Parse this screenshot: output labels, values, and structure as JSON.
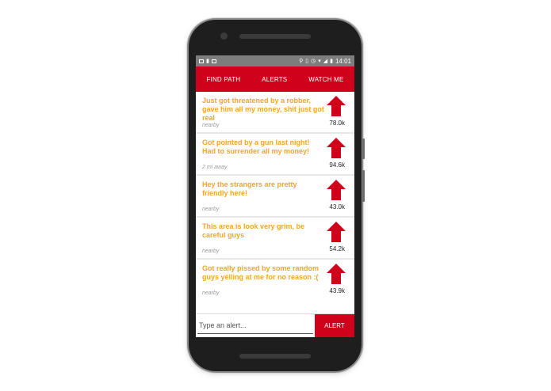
{
  "status_bar": {
    "time": "14:01"
  },
  "tabs": [
    {
      "label": "FIND PATH"
    },
    {
      "label": "ALERTS"
    },
    {
      "label": "WATCH ME"
    }
  ],
  "alerts": [
    {
      "text": "Just got threatened by a robber, gave him all my money, shit just got real",
      "distance": "nearby",
      "count": "78.0k"
    },
    {
      "text": "Got pointed by a gun last night! Had to surrender all my money!",
      "distance": "2 mi away",
      "count": "94.6k"
    },
    {
      "text": "Hey the strangers are pretty friendly here!",
      "distance": "nearby",
      "count": "43.0k"
    },
    {
      "text": "This area is look very grim, be careful guys",
      "distance": "nearby",
      "count": "54.2k"
    },
    {
      "text": "Got really pissed by some random guys yelling at me for no reason :(",
      "distance": "nearby",
      "count": "43.9k"
    }
  ],
  "composer": {
    "placeholder": "Type an alert...",
    "button_label": "ALERT"
  },
  "colors": {
    "accent": "#d0021b",
    "alert_text": "#f5a623"
  },
  "icons": {
    "upvote": "arrow-up-icon"
  }
}
